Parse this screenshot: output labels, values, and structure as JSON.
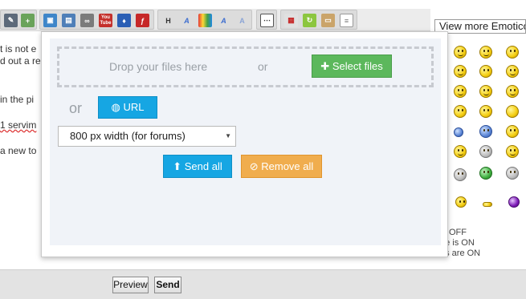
{
  "editor": {
    "text_lines": [
      "t is not e",
      "d out a re",
      "in the pi",
      "1 servim",
      "a new to"
    ],
    "toolbar_icons": [
      "edit-icon",
      "insert-icon",
      "image-icon",
      "image-link-icon",
      "link-icon",
      "youtube-icon",
      "dailymotion-icon",
      "flash-icon",
      "heading-icon",
      "font-size-icon",
      "color-icon",
      "font-icon",
      "strike-icon",
      "hr-icon",
      "date-icon",
      "refresh-icon",
      "paste-icon",
      "page-icon"
    ],
    "youtube_label": "You Tube",
    "heading_label": "H"
  },
  "emoticons": {
    "view_more_label": "View more Emoticons",
    "status_lines": [
      "is OFF",
      "de is ON",
      "es are ON"
    ]
  },
  "upload_dialog": {
    "drop_text": "Drop your files here",
    "drop_or": "or",
    "select_files_label": "Select files",
    "or_label": "or",
    "url_label": "URL",
    "size_selected": "800 px width (for forums)",
    "send_all_label": "Send all",
    "remove_all_label": "Remove all"
  },
  "footer": {
    "preview_label": "Preview",
    "send_label": "Send"
  },
  "colors": {
    "select_green": "#5cb85c",
    "url_blue": "#16a6e3",
    "remove_orange": "#f0ad4e"
  }
}
